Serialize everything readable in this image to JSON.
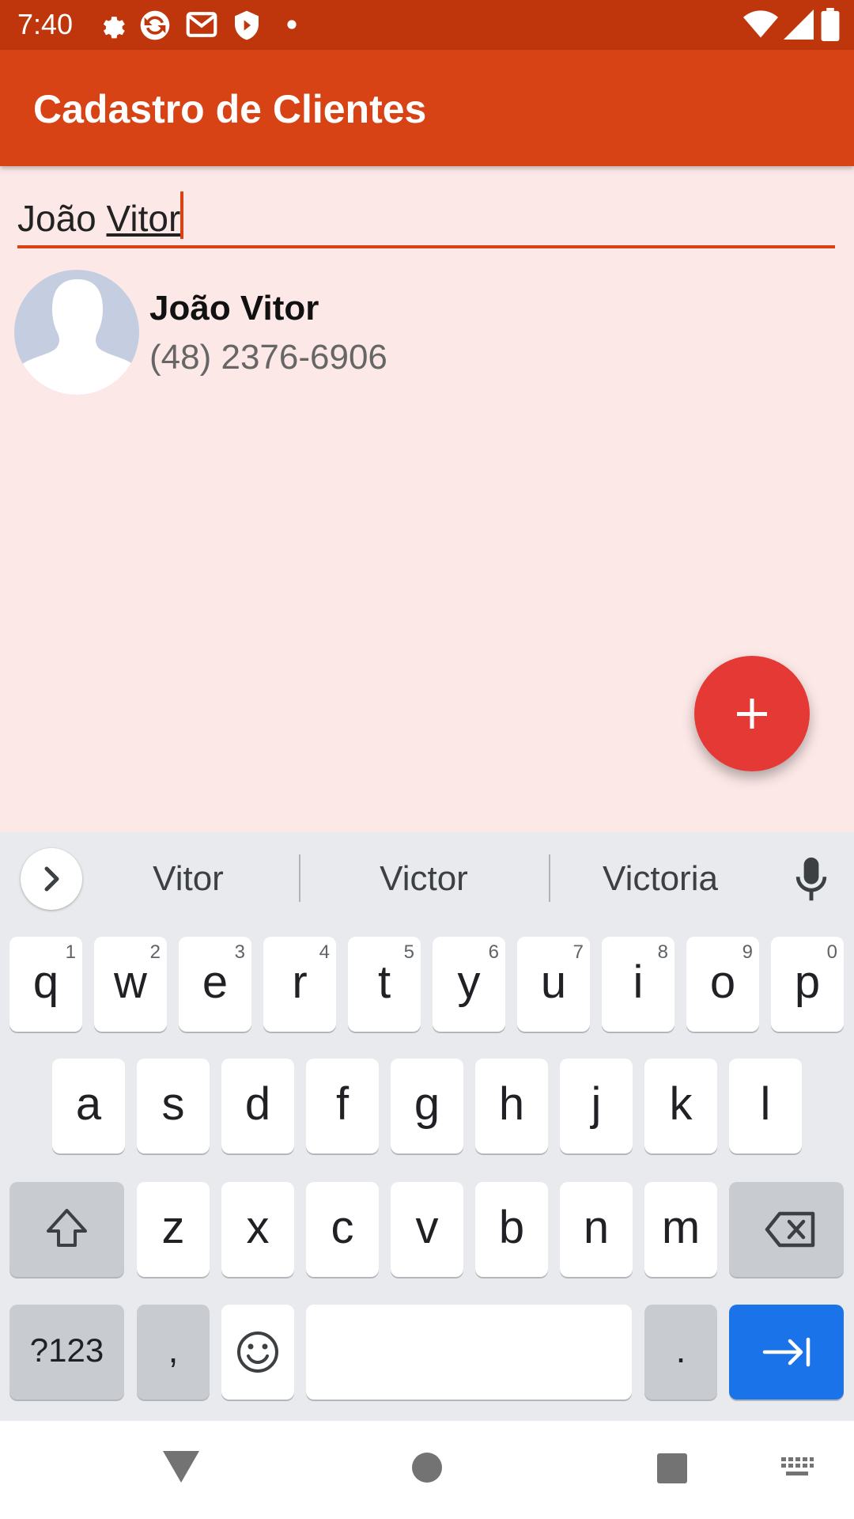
{
  "status_bar": {
    "time": "7:40",
    "icons": [
      "settings-icon",
      "sync-icon",
      "gmail-icon",
      "shield-icon",
      "dot-icon",
      "wifi-icon",
      "signal-icon",
      "battery-icon"
    ]
  },
  "app_bar": {
    "title": "Cadastro de Clientes"
  },
  "search": {
    "value_prefix": "João ",
    "value_underlined": "Vitor"
  },
  "contacts": [
    {
      "name": "João Vitor",
      "phone": "(48) 2376-6906"
    }
  ],
  "fab": {
    "label": "+"
  },
  "keyboard": {
    "suggestions": [
      "Vitor",
      "Victor",
      "Victoria"
    ],
    "row1": [
      {
        "ch": "q",
        "num": "1"
      },
      {
        "ch": "w",
        "num": "2"
      },
      {
        "ch": "e",
        "num": "3"
      },
      {
        "ch": "r",
        "num": "4"
      },
      {
        "ch": "t",
        "num": "5"
      },
      {
        "ch": "y",
        "num": "6"
      },
      {
        "ch": "u",
        "num": "7"
      },
      {
        "ch": "i",
        "num": "8"
      },
      {
        "ch": "o",
        "num": "9"
      },
      {
        "ch": "p",
        "num": "0"
      }
    ],
    "row2": [
      "a",
      "s",
      "d",
      "f",
      "g",
      "h",
      "j",
      "k",
      "l"
    ],
    "row3": [
      "z",
      "x",
      "c",
      "v",
      "b",
      "n",
      "m"
    ],
    "symbols_label": "?123",
    "comma_label": ",",
    "period_label": "."
  },
  "colors": {
    "status_bar": "#bf360c",
    "app_bar": "#d84315",
    "background": "#fce8e7",
    "fab": "#e53935",
    "enter_key": "#1a73e8"
  }
}
